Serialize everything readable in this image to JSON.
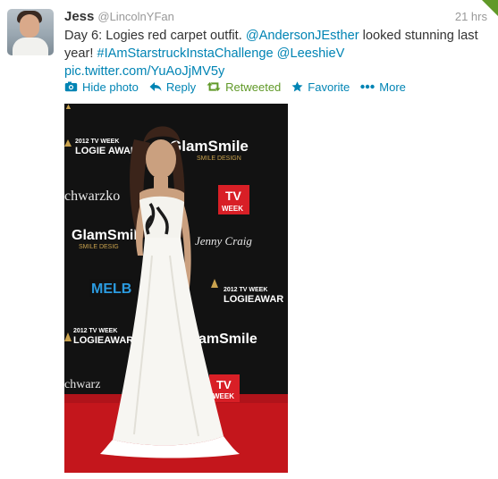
{
  "tweet": {
    "name": "Jess",
    "handle": "@LincolnYFan",
    "time": "21 hrs",
    "text_part1": "Day 6: Logies red carpet outfit. ",
    "mention1": "@AndersonJEsther",
    "text_part2": " looked stunning last year! ",
    "hashtag": "#IAmStarstruckInstaChallenge",
    "text_part3": " ",
    "mention2": "@LeeshieV",
    "pic_link": "pic.twitter.com/YuAoJjMV5y"
  },
  "actions": {
    "hide_photo": "Hide photo",
    "reply": "Reply",
    "retweeted": "Retweeted",
    "favorite": "Favorite",
    "more": "More"
  },
  "photo": {
    "logos": {
      "tv_week": "2012 TV WEEK",
      "logie": "LOGIE AWARDS",
      "logie_short": "LOGIEAWARDS",
      "logie_trunc": "LOGIEAWAR",
      "glamsmile": "GlamSmile",
      "glamsmile_short": "GlamSmil",
      "glamsmile_trunc": "amSmile",
      "smile_design": "SMILE DESIGN",
      "smile_design_short": "SMILE DESIG",
      "schwarzkopf": "chwarzko",
      "schwarzkopf2": "chwarz",
      "tvweek_tv": "TV",
      "tvweek_week": "WEEK",
      "jenny_craig": "Jenny Craig",
      "melb": "MELB"
    }
  },
  "colors": {
    "link": "#0084b4",
    "retweet_green": "#609928",
    "gold": "#c9a24e",
    "carpet": "#c4161c"
  },
  "icons": [
    "photo-icon",
    "reply-icon",
    "retweet-icon",
    "star-icon",
    "dots-icon"
  ]
}
